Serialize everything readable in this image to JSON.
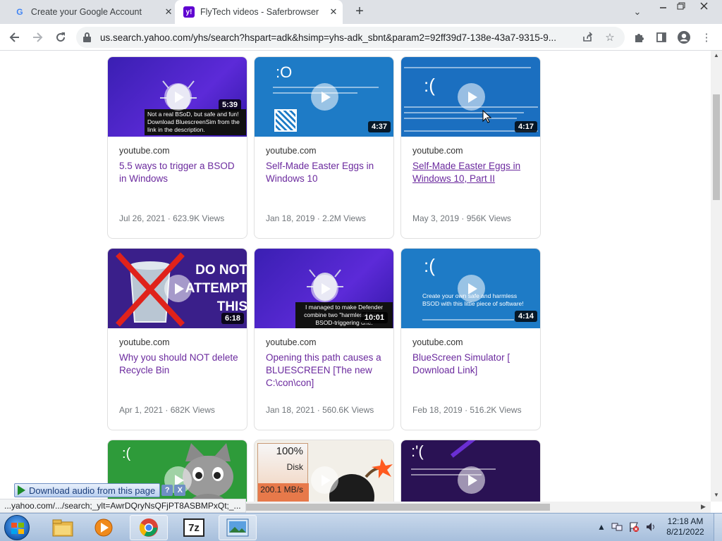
{
  "browser": {
    "tabs": [
      {
        "title": "Create your Google Account",
        "favicon": "G",
        "active": false
      },
      {
        "title": "FlyTech videos - Saferbrowser Yahoo",
        "favicon": "y!",
        "active": true
      }
    ],
    "new_tab_icon": "+",
    "tab_close_icon": "✕",
    "address": "us.search.yahoo.com/yhs/search?hspart=adk&hsimp=yhs-adk_sbnt&param2=92ff39d7-138e-43a7-9315-9..."
  },
  "videos": [
    {
      "source": "youtube.com",
      "title": "5.5 ways to trigger a BSOD in Windows",
      "date": "Jul 26, 2021",
      "views": "623.9K Views",
      "duration": "5:39",
      "thumb_text": "Not a real BSoD, but safe and fun! Download BluescreenSim from the link in the description."
    },
    {
      "source": "youtube.com",
      "title": "Self-Made Easter Eggs in Windows 10",
      "date": "Jan 18, 2019",
      "views": "2.2M Views",
      "duration": "4:37",
      "thumb_text": ":O"
    },
    {
      "source": "youtube.com",
      "title": "Self-Made Easter Eggs in Windows 10, Part II",
      "date": "May 3, 2019",
      "views": "956K Views",
      "duration": "4:17",
      "thumb_text": ":("
    },
    {
      "source": "youtube.com",
      "title": "Why you should NOT delete Recycle Bin",
      "date": "Apr 1, 2021",
      "views": "682K Views",
      "duration": "6:18",
      "thumb_text": "DO NOT ATTEMPT THIS"
    },
    {
      "source": "youtube.com",
      "title": "Opening this path causes a BLUESCREEN [The new C:\\con\\con]",
      "date": "Jan 18, 2021",
      "views": "560.6K Views",
      "duration": "10:01",
      "thumb_text": "I managed to make Defender combine two \"harmless\" into a BSOD-triggering one."
    },
    {
      "source": "youtube.com",
      "title": "BlueScreen Simulator [ Download Link]",
      "date": "Feb 18, 2019",
      "views": "516.2K Views",
      "duration": "4:14",
      "thumb_text": "Create your own safe and harmless BSOD with this little piece of software!"
    }
  ],
  "partial_thumbs": [
    {
      "thumb_text": ":("
    },
    {
      "thumb_text_1": "100%",
      "thumb_text_2": "Disk",
      "thumb_text_3": "200.1 MB/s"
    },
    {
      "thumb_text": ":'("
    }
  ],
  "status_url": "...yahoo.com/.../search;_ylt=AwrDQryNsQFjPT8ASBMPxQt;_...",
  "download_bar": {
    "label": "Download audio from this page",
    "help": "?",
    "close": "X"
  },
  "taskbar": {
    "apps": [
      "file-explorer",
      "media-player",
      "chrome",
      "7zip",
      "image-viewer"
    ],
    "app_7zip_label": "7z",
    "time": "12:18 AM",
    "date": "8/21/2022"
  }
}
